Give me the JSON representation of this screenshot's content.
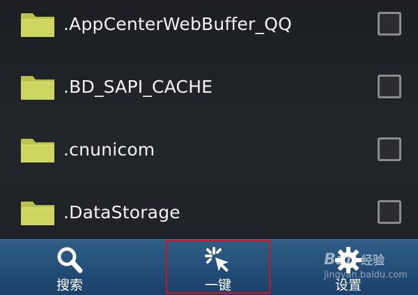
{
  "files": [
    {
      "name": ".AppCenterWebBuffer_QQ",
      "checked": false,
      "icon": "folder-icon"
    },
    {
      "name": ".BD_SAPI_CACHE",
      "checked": false,
      "icon": "folder-icon"
    },
    {
      "name": ".cnunicom",
      "checked": false,
      "icon": "folder-icon"
    },
    {
      "name": ".DataStorage",
      "checked": false,
      "icon": "folder-icon"
    }
  ],
  "toolbar": {
    "search_label": "搜索",
    "search_icon": "magnifier-icon",
    "onekey_label": "一键",
    "onekey_icon": "click-burst-icon",
    "settings_label": "设置",
    "settings_icon": "gear-icon",
    "highlight_color": "#d0141c",
    "bar_color": "#24507a"
  },
  "watermark": {
    "brand": "Bai",
    "brand_suffix": "经验",
    "url": "jingyan.baidu.com"
  },
  "colors": {
    "background": "#1d2024",
    "folder": "#c9d45a",
    "text": "#f4f4f4"
  }
}
